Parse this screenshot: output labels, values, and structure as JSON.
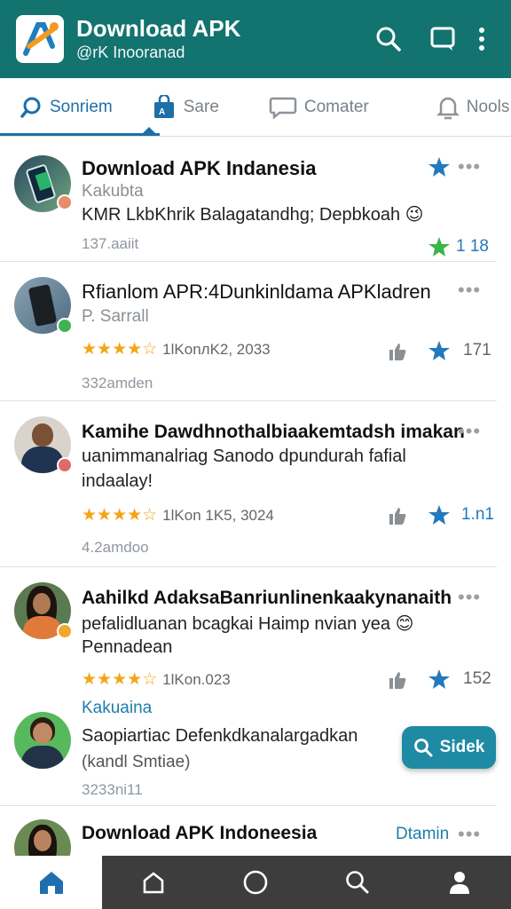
{
  "header": {
    "title": "Download APK",
    "subtitle": "@rK Inooranad",
    "icons": [
      "search-icon",
      "chat-icon",
      "more-vert-icon"
    ]
  },
  "tabs": [
    {
      "label": "Sonriem",
      "icon": "search-icon",
      "active": true
    },
    {
      "label": "Sare",
      "icon": "bag-icon",
      "active": false
    },
    {
      "label": "Comater",
      "icon": "comment-icon",
      "active": false
    },
    {
      "label": "Nools",
      "icon": "bell-icon",
      "active": false
    }
  ],
  "posts": [
    {
      "title": "Download APK Indanesia",
      "line1": "Kakubta",
      "line2": "KMR LkbKhrik Balagatandhg; Depbkoah 😉",
      "meta": "137.aaiit",
      "action_count": "1 18"
    },
    {
      "title": "Rfianlom APR:4Dunkinldama APKladren",
      "line1": "P. Sarrall",
      "rating_text": "1lKonлK2, 2033",
      "meta": "332amden",
      "action_count": "171"
    },
    {
      "title": "Kamihe Dawdhnothalbiaakemtadsh imakan",
      "line1": "uanimmanalriag Sanodo dpundurah fafial",
      "line2": "indaalay!",
      "rating_text": "1lKon 1K5, 3024",
      "meta": "4.2amdoo",
      "action_count": "1.n1"
    },
    {
      "title": "Aahilkd AdaksaBanriunlinenkaakynanaith",
      "line1": "pefalidluanan bcagkai Haimp nvian yea 😊",
      "line2": "Pennadean",
      "rating_text": "1lKon.023",
      "action_count": "152",
      "tag": "Kakuaina"
    },
    {
      "title": "Saopiartiac Defenkdkanalargadkan",
      "line1": "(kandl Smtiae)",
      "meta": "3233ni11"
    },
    {
      "title": "Download APK Indoneesia",
      "link": "Dtamin"
    }
  ],
  "fab": {
    "label": "Sidek",
    "icon": "search-icon"
  },
  "bottom_nav": [
    "home-icon",
    "profile-home-icon",
    "circle-icon",
    "search-icon",
    "person-icon"
  ],
  "colors": {
    "header": "#12736f",
    "accent": "#1e6fa8",
    "star": "#f2a516",
    "bottom_nav": "#3d3d3d"
  }
}
